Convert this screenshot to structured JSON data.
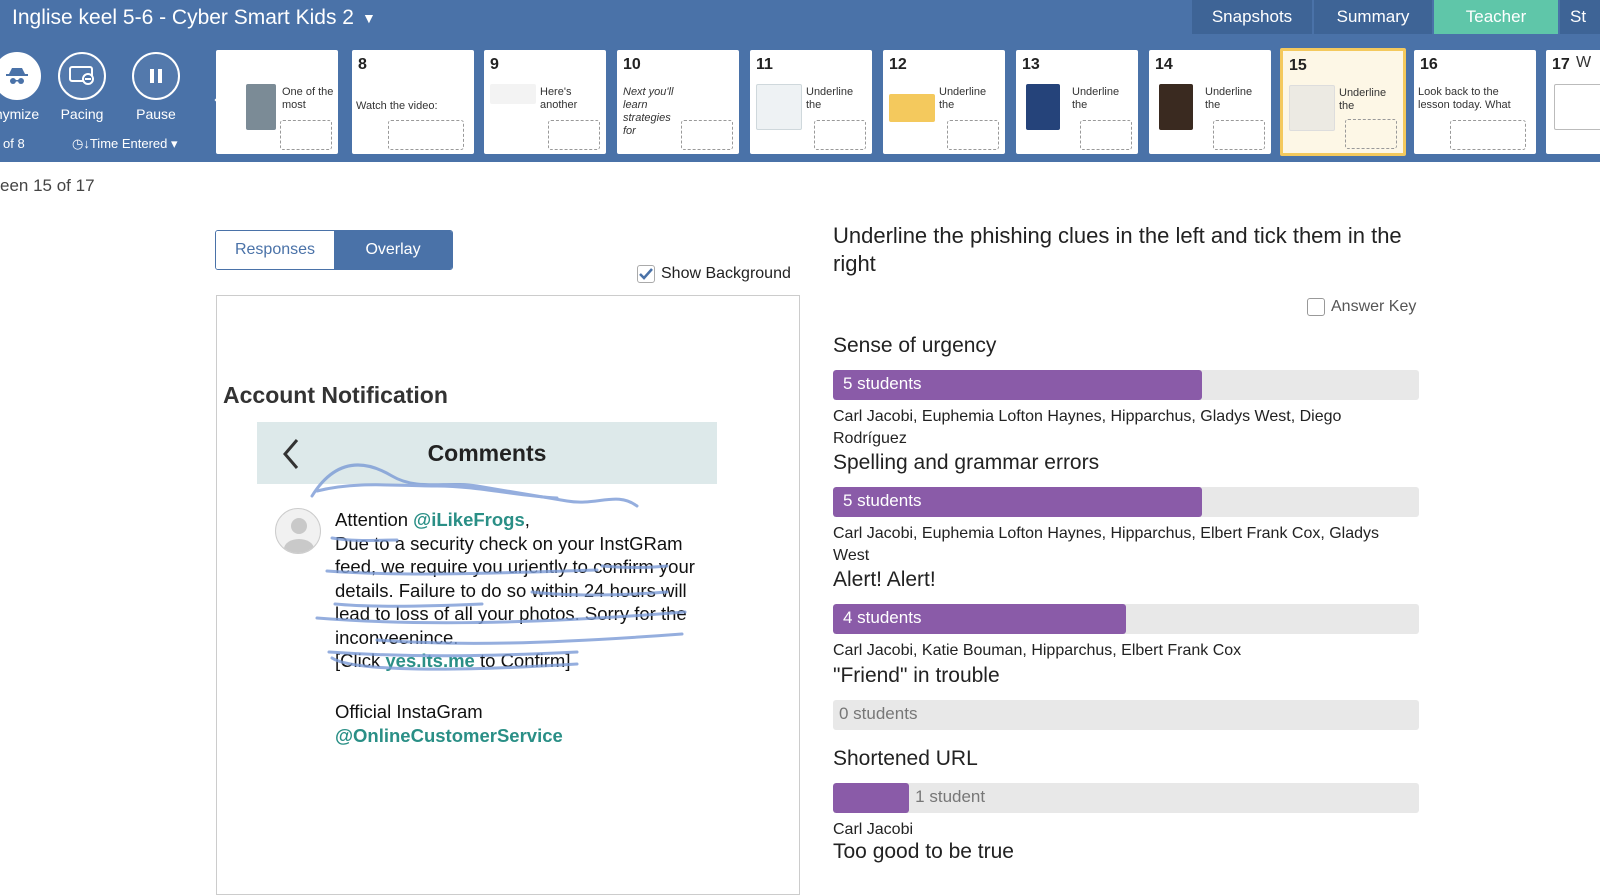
{
  "header": {
    "title": "Inglise keel 5-6 - Cyber Smart Kids 2",
    "tabs": [
      "Snapshots",
      "Summary",
      "Teacher",
      "St"
    ]
  },
  "toolbar": {
    "anonymize": "nymize",
    "anonymize_sub": "of 8",
    "pacing": "Pacing",
    "pause": "Pause",
    "sort": "Time Entered"
  },
  "filmstrip": [
    {
      "num": "",
      "label": "One of the most"
    },
    {
      "num": "8",
      "label": "Watch the video:"
    },
    {
      "num": "9",
      "label": "Here's another"
    },
    {
      "num": "10",
      "label": "Next you'll learn strategies for"
    },
    {
      "num": "11",
      "label": "Underline the"
    },
    {
      "num": "12",
      "label": "Underline the"
    },
    {
      "num": "13",
      "label": "Underline the"
    },
    {
      "num": "14",
      "label": "Underline the"
    },
    {
      "num": "15",
      "label": "Underline the"
    },
    {
      "num": "16",
      "label": "Look back to the lesson today. What"
    },
    {
      "num": "17",
      "label": "W"
    }
  ],
  "screen_count": "een 15 of 17",
  "view_toggle": {
    "responses": "Responses",
    "overlay": "Overlay"
  },
  "show_background": "Show Background",
  "overlay": {
    "heading": "Account Notification",
    "phone_title": "Comments",
    "msg_attention": "Attention ",
    "msg_handle": "@iLikeFrogs",
    "msg_comma": ",",
    "msg_body": "Due to a security check on your InstGRam feed, we require you urjently to confirm your details. Failure to do so within 24 hours will lead to loss of all your photos. Sorry for the inconveenince.",
    "msg_click_pre": "[Click ",
    "msg_link": "yes.its.me",
    "msg_click_post": " to Confirm]",
    "sig_line1": "Official InstaGram",
    "sig_line2": "@OnlineCustomerService"
  },
  "prompt": "Underline the phishing clues in the left and tick them in the right",
  "answer_key": "Answer Key",
  "items": [
    {
      "title": "Sense of urgency",
      "count": "5 students",
      "fraction": 0.63,
      "names": "Carl Jacobi, Euphemia Lofton Haynes, Hipparchus, Gladys West, Diego Rodríguez"
    },
    {
      "title": "Spelling and grammar errors",
      "count": "5 students",
      "fraction": 0.63,
      "names": "Carl Jacobi, Euphemia Lofton Haynes, Hipparchus, Elbert Frank Cox, Gladys West"
    },
    {
      "title": "Alert! Alert!",
      "count": "4 students",
      "fraction": 0.5,
      "names": "Carl Jacobi, Katie Bouman, Hipparchus, Elbert Frank Cox"
    },
    {
      "title": "\"Friend\" in trouble",
      "count": "0 students",
      "fraction": 0,
      "names": ""
    },
    {
      "title": "Shortened URL",
      "count": "1 student",
      "fraction": 0.13,
      "names": "Carl Jacobi"
    },
    {
      "title": "Too good to be true",
      "count": "",
      "fraction": 0,
      "names": ""
    }
  ],
  "colors": {
    "header": "#4a72a8",
    "active_tab": "#5fc6a9",
    "bar": "#8a5ba8",
    "selected_card": "#f4c95d"
  }
}
